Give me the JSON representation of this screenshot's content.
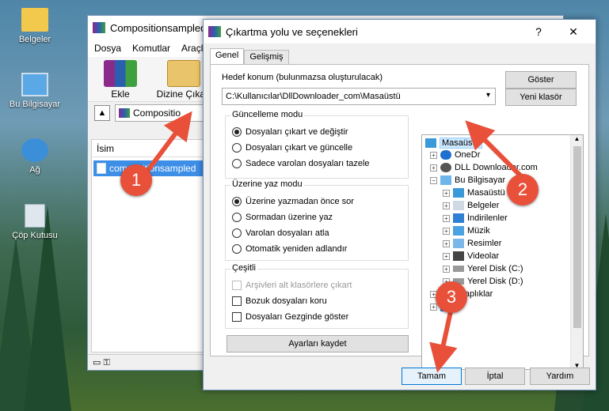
{
  "desktop": {
    "icons": [
      {
        "label": "Belgeler"
      },
      {
        "label": "Bu Bilgisayar"
      },
      {
        "label": "Ağ"
      },
      {
        "label": "Çöp Kutusu"
      }
    ]
  },
  "rar": {
    "title": "Compositionsampled",
    "menu": [
      "Dosya",
      "Komutlar",
      "Araçla"
    ],
    "toolbar": {
      "add": "Ekle",
      "extract": "Dizine Çıkart"
    },
    "path": "Compositio",
    "column": "İsim",
    "file": "compositionsampled"
  },
  "dialog": {
    "title": "Çıkartma yolu ve seçenekleri",
    "help": "?",
    "close": "✕",
    "tabs": [
      "Genel",
      "Gelişmiş"
    ],
    "dest_label": "Hedef konum (bulunmazsa oluşturulacak)",
    "dest_value": "C:\\Kullanıcılar\\DllDownloader_com\\Masaüstü",
    "show_btn": "Göster",
    "new_folder_btn": "Yeni klasör",
    "update_group": {
      "title": "Güncelleme modu",
      "options": [
        "Dosyaları çıkart ve değiştir",
        "Dosyaları çıkart ve güncelle",
        "Sadece varolan dosyaları tazele"
      ]
    },
    "overwrite_group": {
      "title": "Üzerine yaz modu",
      "options": [
        "Üzerine yazmadan önce sor",
        "Sormadan üzerine yaz",
        "Varolan dosyaları atla",
        "Otomatik yeniden adlandır"
      ]
    },
    "misc_group": {
      "title": "Çeşitli",
      "options": [
        "Arşivleri alt klasörlere çıkart",
        "Bozuk dosyaları koru",
        "Dosyaları Gezginde göster"
      ]
    },
    "save_settings": "Ayarları kaydet",
    "tree": [
      "Masaüstü",
      "OneDr",
      "DLL Downloader.com",
      "Bu Bilgisayar",
      "Masaüstü",
      "Belgeler",
      "İndirilenler",
      "Müzik",
      "Resimler",
      "Videolar",
      "Yerel Disk (C:)",
      "Yerel Disk (D:)",
      "Kitaplıklar"
    ],
    "ok": "Tamam",
    "cancel": "İptal",
    "helpbtn": "Yardım"
  },
  "badges": [
    "1",
    "2",
    "3"
  ]
}
